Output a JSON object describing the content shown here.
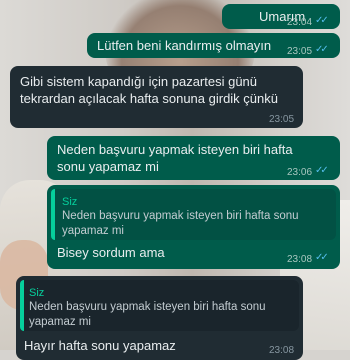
{
  "messages": [
    {
      "text": "Umarım",
      "time": "23:04"
    },
    {
      "text": "Lütfen beni kandırmış olmayın",
      "time": "23:05"
    },
    {
      "line1": "Gibi sistem kapandığı için pazartesi günü",
      "line2": "tekrardan açılacak hafta sonuna girdik çünkü",
      "time": "23:05"
    },
    {
      "line1": "Neden başvuru yapmak isteyen biri hafta",
      "line2": "sonu yapamaz mi",
      "time": "23:06"
    },
    {
      "quote_author": "Siz",
      "quote_line1": "Neden başvuru yapmak isteyen biri hafta sonu",
      "quote_line2": "yapamaz mi",
      "text": "Bisey sordum ama",
      "time": "23:08"
    },
    {
      "quote_author": "Siz",
      "quote_line1": "Neden başvuru yapmak isteyen biri hafta sonu",
      "quote_line2": "yapamaz mi",
      "text": "Hayır hafta sonu yapamaz",
      "time": "23:08"
    }
  ],
  "colors": {
    "outgoing_bubble": "#005c4b",
    "incoming_bubble": "#202c33",
    "read_ticks": "#53bdeb",
    "quote_accent": "#06cf9c"
  },
  "icons": {
    "read_receipt": "double-check-icon"
  }
}
